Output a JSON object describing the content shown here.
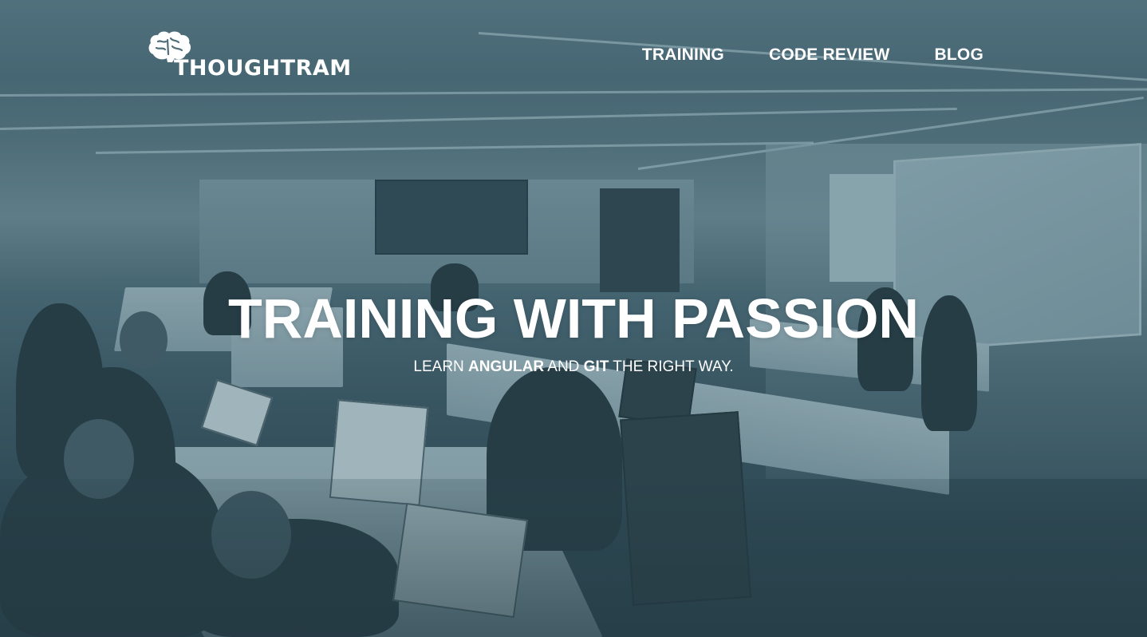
{
  "brand": {
    "logo_text": "THOUGHTRAM"
  },
  "nav": {
    "items": [
      {
        "id": "training",
        "label": "TRAINING"
      },
      {
        "id": "code-review",
        "label": "CODE REVIEW"
      },
      {
        "id": "blog",
        "label": "BLOG"
      }
    ]
  },
  "hero": {
    "headline": "TRAINING WITH PASSION",
    "subline": {
      "part1": "LEARN ",
      "em1": "ANGULAR",
      "part2": " AND ",
      "em2": "GIT",
      "part3": " THE RIGHT WAY."
    }
  },
  "theme": {
    "overlay_color": "#3e5a66",
    "text_color": "#ffffff"
  },
  "icons": {
    "logo_mark": "brain-icon"
  }
}
